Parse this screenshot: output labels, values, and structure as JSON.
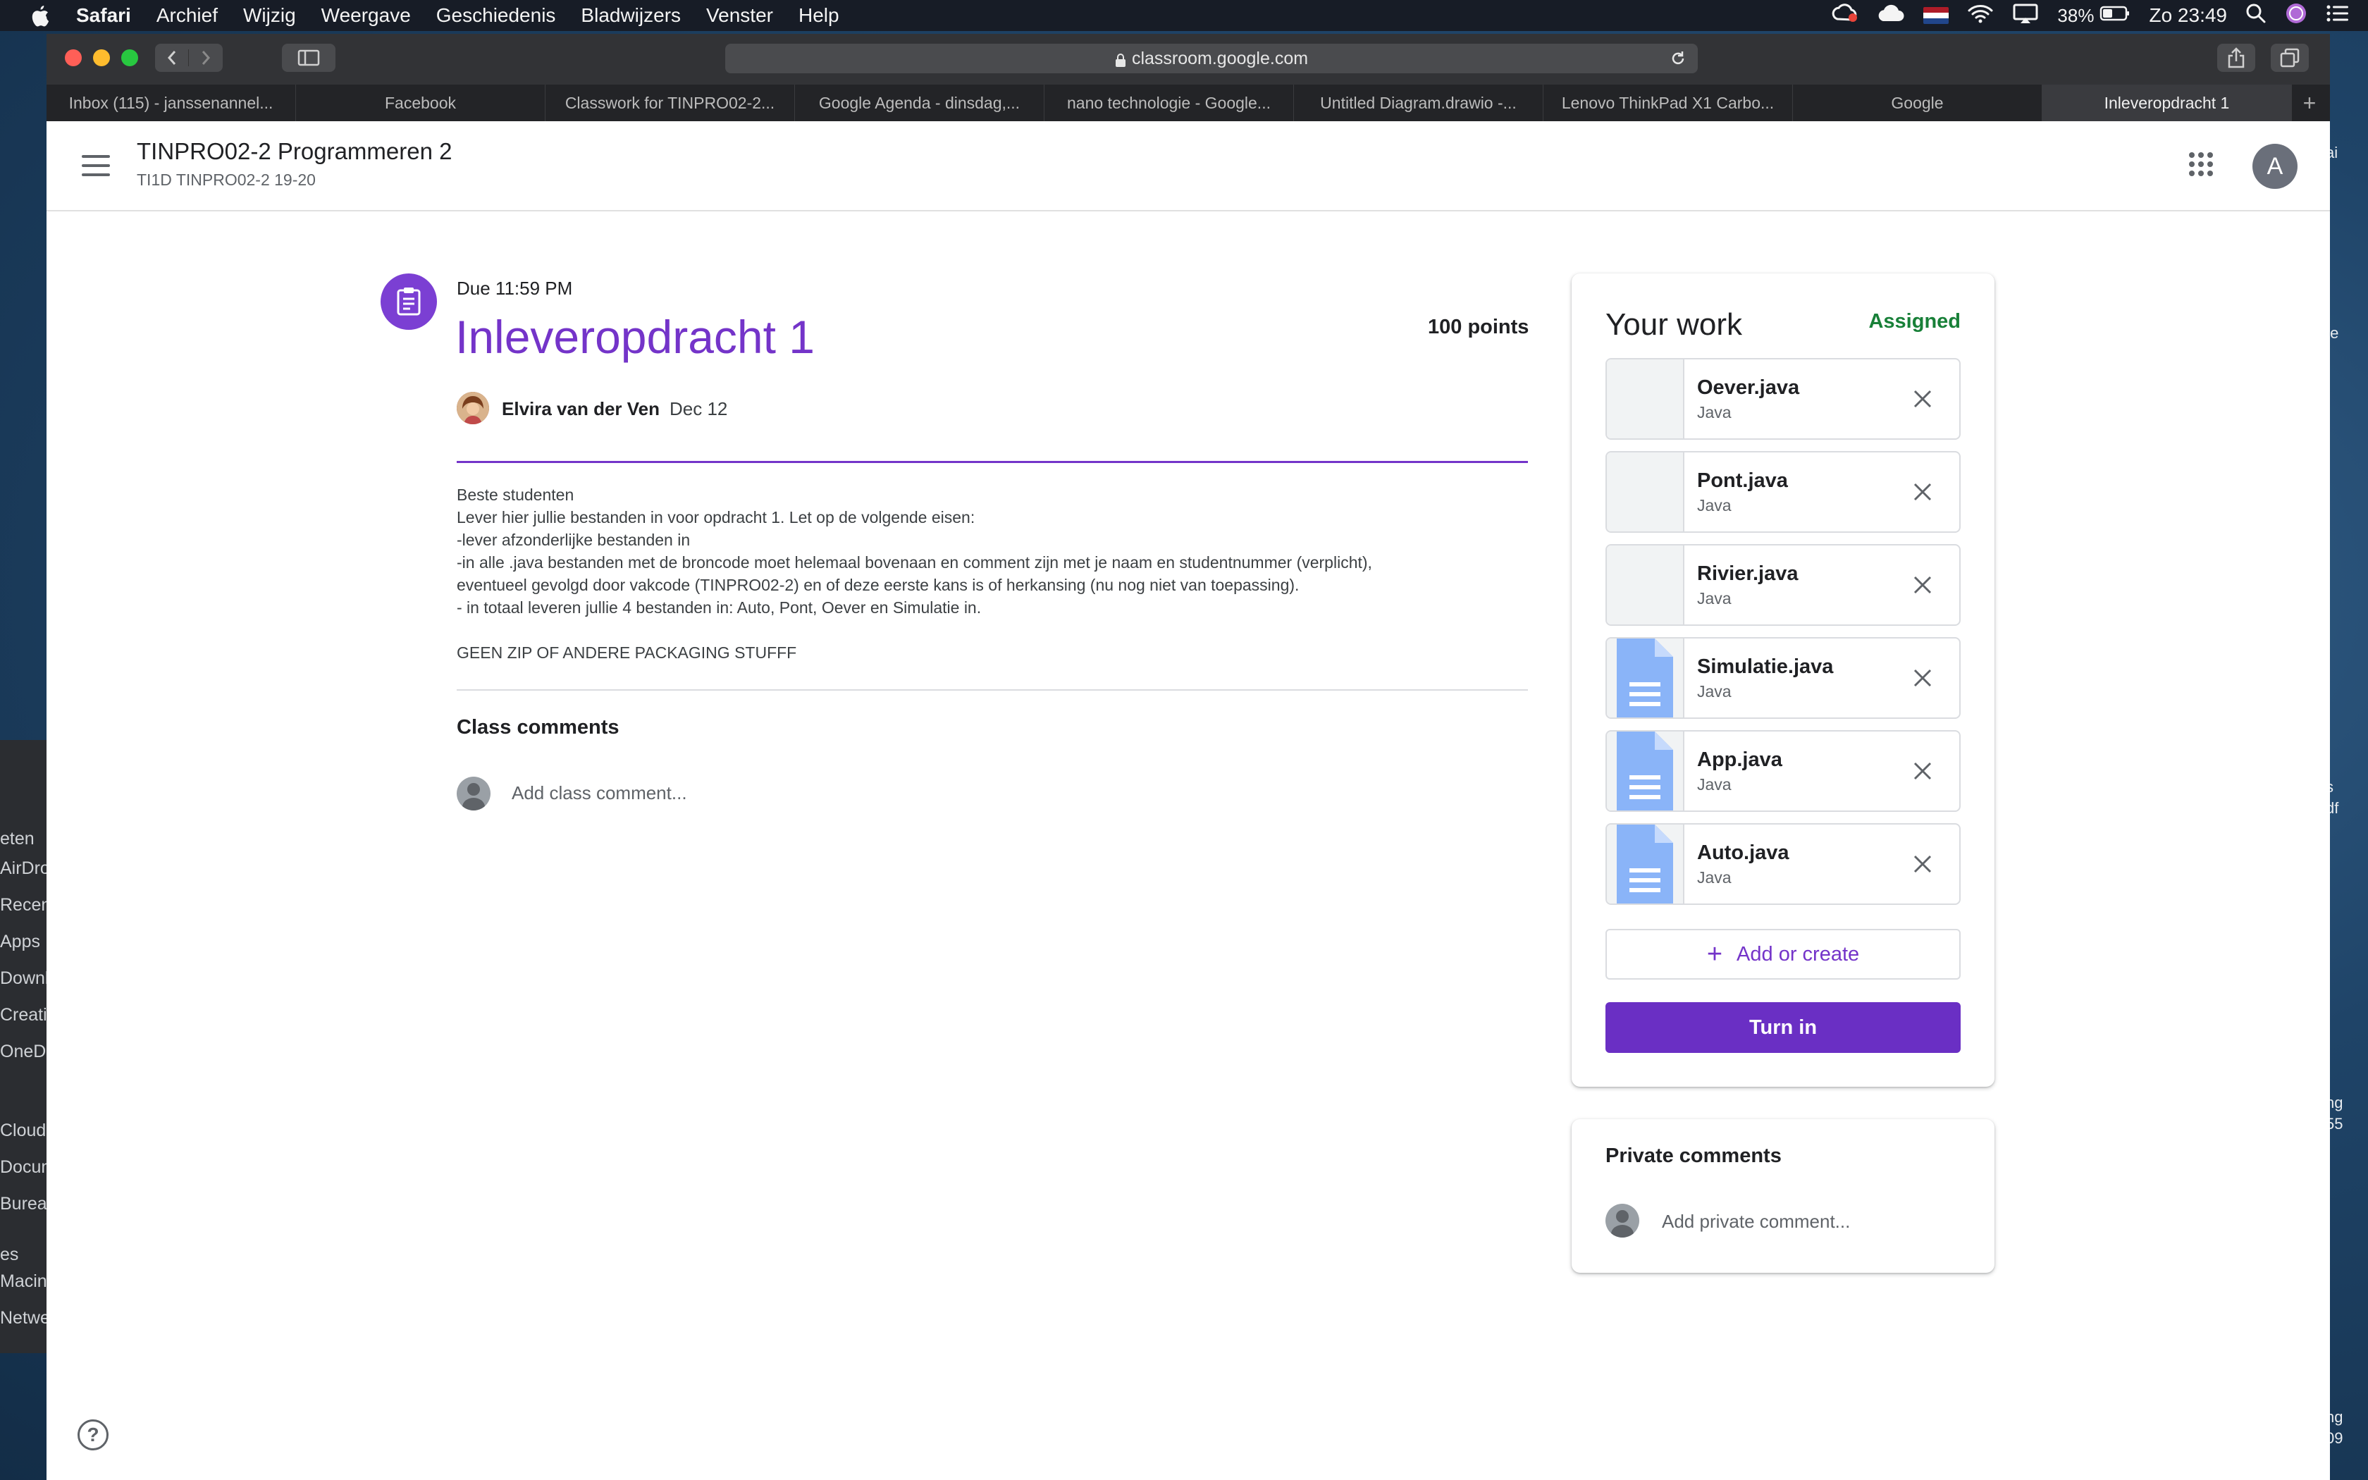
{
  "menubar": {
    "app": "Safari",
    "items": [
      "Archief",
      "Wijzig",
      "Weergave",
      "Geschiedenis",
      "Bladwijzers",
      "Venster",
      "Help"
    ],
    "battery": "38%",
    "clock": "Zo 23:49",
    "flag_colors": [
      "#ae1c28",
      "#ffffff",
      "#21468b"
    ]
  },
  "browser": {
    "url": "classroom.google.com",
    "tabs": [
      {
        "label": "Inbox (115) - janssenannel..."
      },
      {
        "label": "Facebook"
      },
      {
        "label": "Classwork for TINPRO02-2..."
      },
      {
        "label": "Google Agenda - dinsdag,..."
      },
      {
        "label": "nano technologie - Google..."
      },
      {
        "label": "Untitled Diagram.drawio -..."
      },
      {
        "label": "Lenovo ThinkPad X1 Carbo..."
      },
      {
        "label": "Google"
      },
      {
        "label": "Inleveropdracht 1"
      }
    ],
    "new_tab": "+"
  },
  "desktop": {
    "sidebar_items": [
      "eten",
      "AirDro",
      "Recen",
      "Apps",
      "Downl",
      "Creativ",
      "OneDr",
      "Cloud",
      "Docum",
      "Bureau",
      "es",
      "Macint",
      "Netwe"
    ],
    "right_fragments": [
      "ai",
      "te",
      "s",
      "df",
      "ng",
      "55",
      "ng",
      "09"
    ]
  },
  "header": {
    "course_title": "TINPRO02-2 Programmeren 2",
    "course_subtitle": "TI1D TINPRO02-2 19-20",
    "account_initial": "A"
  },
  "assignment": {
    "due": "Due 11:59 PM",
    "title": "Inleveropdracht 1",
    "points": "100 points",
    "author": "Elvira van der Ven",
    "date": "Dec 12",
    "description": [
      "Beste studenten",
      "Lever hier jullie bestanden in voor opdracht 1. Let op de volgende eisen:",
      "-lever afzonderlijke bestanden in",
      "-in alle .java bestanden met de broncode moet helemaal bovenaan en comment zijn met je naam en studentnummer (verplicht),",
      "eventueel gevolgd door vakcode (TINPRO02-2) en of deze eerste kans is of herkansing (nu nog niet van toepassing).",
      "- in totaal leveren jullie 4 bestanden in: Auto, Pont, Oever en Simulatie in.",
      "",
      "GEEN ZIP OF ANDERE PACKAGING STUFFF"
    ]
  },
  "class_comments": {
    "title": "Class comments",
    "placeholder": "Add class comment..."
  },
  "your_work": {
    "title": "Your work",
    "status": "Assigned",
    "status_color": "#188038",
    "attachments": [
      {
        "name": "Oever.java",
        "type": "Java",
        "thumbnail": "blank"
      },
      {
        "name": "Pont.java",
        "type": "Java",
        "thumbnail": "blank"
      },
      {
        "name": "Rivier.java",
        "type": "Java",
        "thumbnail": "blank"
      },
      {
        "name": "Simulatie.java",
        "type": "Java",
        "thumbnail": "doc-icon"
      },
      {
        "name": "App.java",
        "type": "Java",
        "thumbnail": "doc-icon"
      },
      {
        "name": "Auto.java",
        "type": "Java",
        "thumbnail": "doc-icon"
      }
    ],
    "add_or_create": "Add or create",
    "turn_in": "Turn in",
    "accent": "#6a2fc4"
  },
  "private_comments": {
    "title": "Private comments",
    "placeholder": "Add private comment..."
  },
  "help": "?"
}
